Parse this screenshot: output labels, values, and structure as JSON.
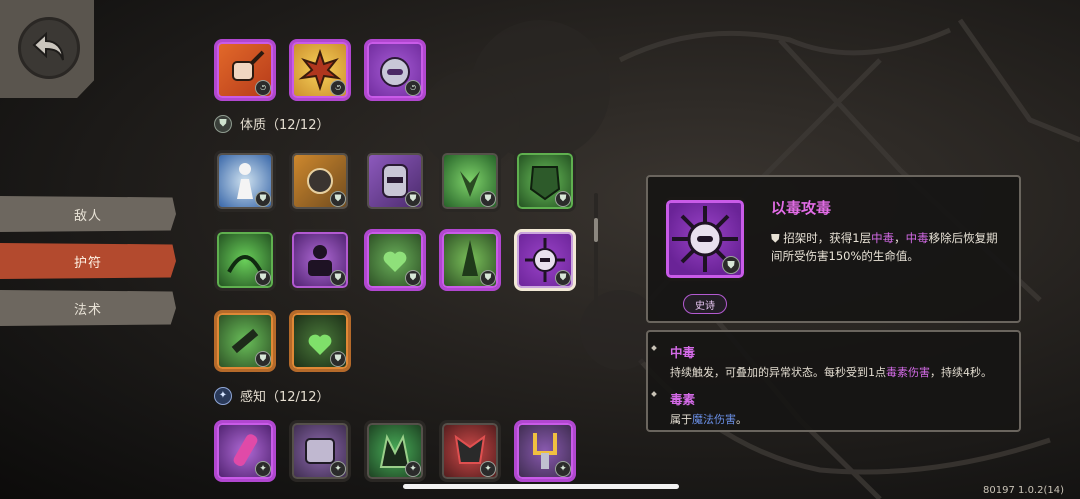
{
  "nav": {
    "items": [
      {
        "label": "敌人",
        "state": "inactive"
      },
      {
        "label": "护符",
        "state": "active"
      },
      {
        "label": "法术",
        "state": "inactive"
      }
    ]
  },
  "sections": [
    {
      "label": "体质（12/12）",
      "icon": "shield-icon"
    },
    {
      "label": "感知（12/12）",
      "icon": "spark-icon"
    }
  ],
  "grid_badges": {
    "shield": "⛊",
    "swirl": "૭",
    "spark": "✦"
  },
  "detail": {
    "title": "以毒攻毒",
    "desc_prefix": "⛊ 招架时，获得1层",
    "desc_term1": "中毒",
    "desc_mid": "，",
    "desc_term2": "中毒",
    "desc_suffix": "移除后恢复期间所受伤害150%的生命值。",
    "rarity": "史诗"
  },
  "glossary": [
    {
      "term": "中毒",
      "desc_a": "持续触发，可叠加的异常状态。每秒受到1点",
      "desc_hl": "毒素伤害",
      "desc_b": "，持续4秒。"
    },
    {
      "term": "毒素",
      "desc_a": "属于",
      "desc_hl": "魔法伤害",
      "desc_b": "。"
    }
  ],
  "version": "80197 1.0.2(14)",
  "colors": {
    "accent_active": "#b34a2e",
    "epic": "#c95be8",
    "rare": "#e08836",
    "hl": "#d36ae6"
  }
}
